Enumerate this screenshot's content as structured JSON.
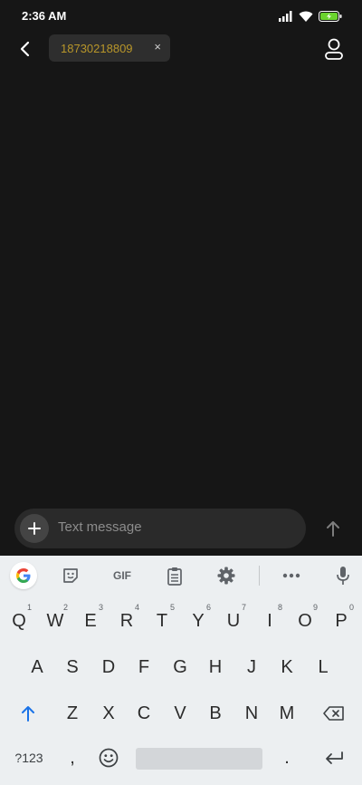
{
  "status": {
    "time": "2:36 AM",
    "icons": [
      "signal-icon",
      "wifi-icon",
      "battery-charging-icon"
    ],
    "battery_color": "#6bd32e"
  },
  "appbar": {
    "recipient": "18730218809",
    "chip_close": "×"
  },
  "composer": {
    "placeholder": "Text message"
  },
  "keyboard": {
    "toolbar_gif": "GIF",
    "row1": [
      {
        "k": "Q",
        "h": "1"
      },
      {
        "k": "W",
        "h": "2"
      },
      {
        "k": "E",
        "h": "3"
      },
      {
        "k": "R",
        "h": "4"
      },
      {
        "k": "T",
        "h": "5"
      },
      {
        "k": "Y",
        "h": "6"
      },
      {
        "k": "U",
        "h": "7"
      },
      {
        "k": "I",
        "h": "8"
      },
      {
        "k": "O",
        "h": "9"
      },
      {
        "k": "P",
        "h": "0"
      }
    ],
    "row2": [
      "A",
      "S",
      "D",
      "F",
      "G",
      "H",
      "J",
      "K",
      "L"
    ],
    "row3": [
      "Z",
      "X",
      "C",
      "V",
      "B",
      "N",
      "M"
    ],
    "symbols_label": "?123",
    "comma": ",",
    "period": "."
  },
  "colors": {
    "background": "#161616",
    "chip": "#2e2e2e",
    "chip_text": "#b8962a",
    "keyboard_bg": "#eceff1",
    "shift_active": "#1a73e8"
  }
}
